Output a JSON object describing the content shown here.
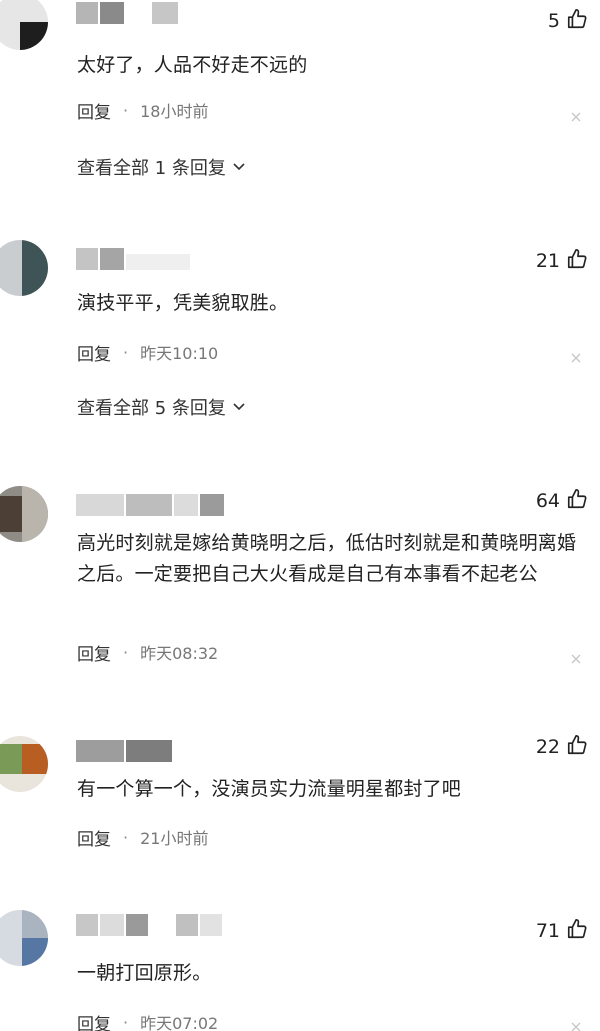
{
  "comments": [
    {
      "likes": "5",
      "text": "太好了，人品不好走不远的",
      "reply_label": "回复",
      "time": "18小时前",
      "view_all": "查看全部 1 条回复"
    },
    {
      "likes": "21",
      "text": "演技平平，凭美貌取胜。",
      "reply_label": "回复",
      "time": "昨天10:10",
      "view_all": "查看全部 5 条回复"
    },
    {
      "likes": "64",
      "text": "高光时刻就是嫁给黄晓明之后，低估时刻就是和黄晓明离婚之后。一定要把自己大火看成是自己有本事看不起老公",
      "reply_label": "回复",
      "time": "昨天08:32"
    },
    {
      "likes": "22",
      "text": "有一个算一个，没演员实力流量明星都封了吧",
      "reply_label": "回复",
      "time": "21小时前"
    },
    {
      "likes": "71",
      "text": "一朝打回原形。",
      "reply_label": "回复",
      "time": "昨天07:02"
    }
  ],
  "icons": {
    "like": "thumbs-up-icon",
    "close": "close-icon",
    "expand": "chevron-down-icon"
  },
  "colors": {
    "text": "#222222",
    "meta": "#777777",
    "blur_gray": "#9a9a9a"
  }
}
